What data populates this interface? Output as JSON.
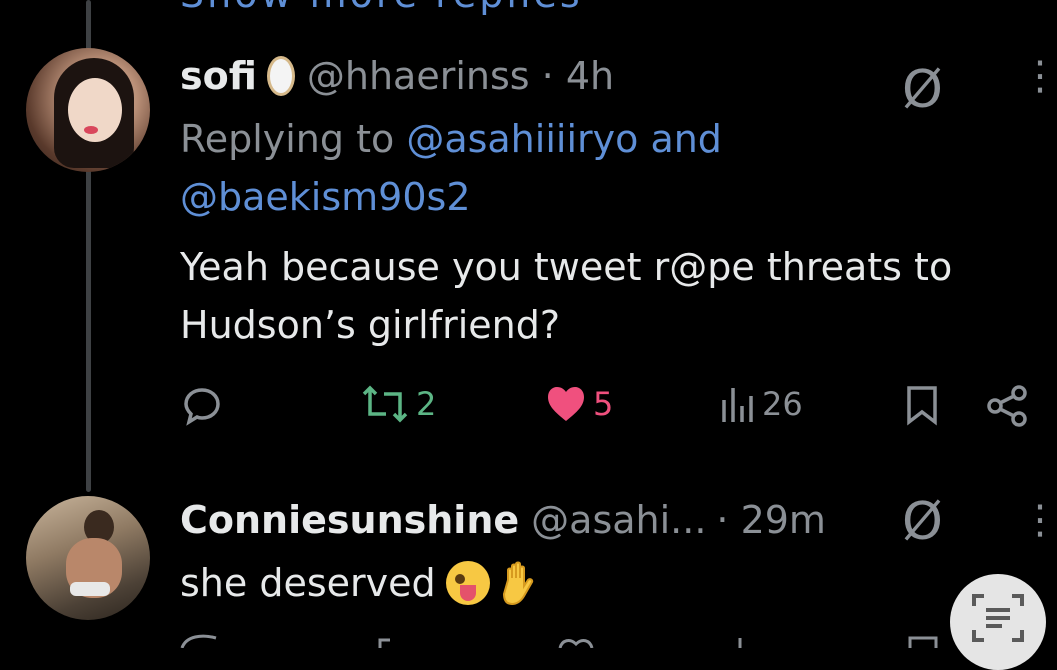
{
  "top": {
    "partial_text": "Show more replies"
  },
  "tweet1": {
    "name": "sofi",
    "badge_icon": "mirror-emoji",
    "handle_time": "@hhaerinss · 4h",
    "replying_prefix": "Replying to ",
    "reply_handle_1": "@asahiiiiryo",
    "reply_and": " and",
    "reply_handle_2": "@baekism90s2",
    "body_line1": "Yeah because you tweet r@pe threats to",
    "body_line2": "Hudson’s girlfriend?",
    "actions": {
      "retweet_count": "2",
      "like_count": "5",
      "views_count": "26"
    }
  },
  "tweet2": {
    "name": "Conniesunshine",
    "handle": "@asahi...",
    "time": "· 29m",
    "body": "she deserved",
    "emojis": [
      "zany-face",
      "raised-hand"
    ]
  },
  "colors": {
    "background": "#000000",
    "link": "#5f8fd6",
    "muted": "#8b9096",
    "retweet": "#5cb585",
    "like": "#f0507e"
  }
}
